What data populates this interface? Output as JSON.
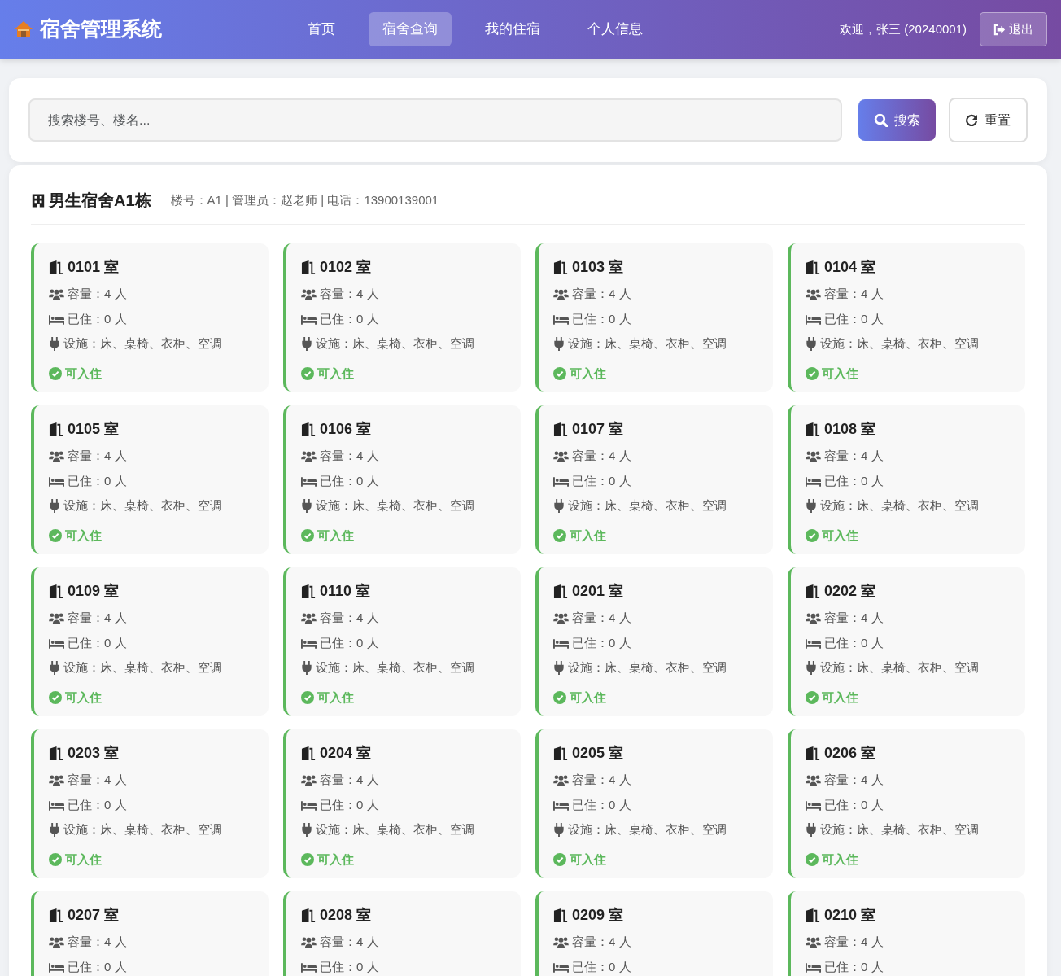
{
  "navbar": {
    "brand": "宿舍管理系统",
    "links": [
      {
        "label": "首页",
        "selected": false
      },
      {
        "label": "宿舍查询",
        "selected": true
      },
      {
        "label": "我的住宿",
        "selected": false
      },
      {
        "label": "个人信息",
        "selected": false
      }
    ],
    "welcome": "欢迎，张三 (20240001)",
    "logout": "退出"
  },
  "search": {
    "placeholder": "搜索楼号、楼名...",
    "search_button": "搜索",
    "reset_button": "重置"
  },
  "building": {
    "name": "男生宿舍A1栋",
    "info": "楼号：A1 | 管理员：赵老师 | 电话：13900139001"
  },
  "rooms": [
    {
      "title": "0101 室",
      "capacity": "容量：4 人",
      "occupied": "已住：0 人",
      "facilities": "设施：床、桌椅、衣柜、空调",
      "status": {
        "kind": "available",
        "text": "可入住"
      }
    },
    {
      "title": "0102 室",
      "capacity": "容量：4 人",
      "occupied": "已住：0 人",
      "facilities": "设施：床、桌椅、衣柜、空调",
      "status": {
        "kind": "available",
        "text": "可入住"
      }
    },
    {
      "title": "0103 室",
      "capacity": "容量：4 人",
      "occupied": "已住：0 人",
      "facilities": "设施：床、桌椅、衣柜、空调",
      "status": {
        "kind": "available",
        "text": "可入住"
      }
    },
    {
      "title": "0104 室",
      "capacity": "容量：4 人",
      "occupied": "已住：0 人",
      "facilities": "设施：床、桌椅、衣柜、空调",
      "status": {
        "kind": "available",
        "text": "可入住"
      }
    },
    {
      "title": "0105 室",
      "capacity": "容量：4 人",
      "occupied": "已住：0 人",
      "facilities": "设施：床、桌椅、衣柜、空调",
      "status": {
        "kind": "available",
        "text": "可入住"
      }
    },
    {
      "title": "0106 室",
      "capacity": "容量：4 人",
      "occupied": "已住：0 人",
      "facilities": "设施：床、桌椅、衣柜、空调",
      "status": {
        "kind": "available",
        "text": "可入住"
      }
    },
    {
      "title": "0107 室",
      "capacity": "容量：4 人",
      "occupied": "已住：0 人",
      "facilities": "设施：床、桌椅、衣柜、空调",
      "status": {
        "kind": "available",
        "text": "可入住"
      }
    },
    {
      "title": "0108 室",
      "capacity": "容量：4 人",
      "occupied": "已住：0 人",
      "facilities": "设施：床、桌椅、衣柜、空调",
      "status": {
        "kind": "available",
        "text": "可入住"
      }
    },
    {
      "title": "0109 室",
      "capacity": "容量：4 人",
      "occupied": "已住：0 人",
      "facilities": "设施：床、桌椅、衣柜、空调",
      "status": {
        "kind": "available",
        "text": "可入住"
      }
    },
    {
      "title": "0110 室",
      "capacity": "容量：4 人",
      "occupied": "已住：0 人",
      "facilities": "设施：床、桌椅、衣柜、空调",
      "status": {
        "kind": "available",
        "text": "可入住"
      }
    },
    {
      "title": "0201 室",
      "capacity": "容量：4 人",
      "occupied": "已住：0 人",
      "facilities": "设施：床、桌椅、衣柜、空调",
      "status": {
        "kind": "available",
        "text": "可入住"
      }
    },
    {
      "title": "0202 室",
      "capacity": "容量：4 人",
      "occupied": "已住：0 人",
      "facilities": "设施：床、桌椅、衣柜、空调",
      "status": {
        "kind": "available",
        "text": "可入住"
      }
    },
    {
      "title": "0203 室",
      "capacity": "容量：4 人",
      "occupied": "已住：0 人",
      "facilities": "设施：床、桌椅、衣柜、空调",
      "status": {
        "kind": "available",
        "text": "可入住"
      }
    },
    {
      "title": "0204 室",
      "capacity": "容量：4 人",
      "occupied": "已住：0 人",
      "facilities": "设施：床、桌椅、衣柜、空调",
      "status": {
        "kind": "available",
        "text": "可入住"
      }
    },
    {
      "title": "0205 室",
      "capacity": "容量：4 人",
      "occupied": "已住：0 人",
      "facilities": "设施：床、桌椅、衣柜、空调",
      "status": {
        "kind": "available",
        "text": "可入住"
      }
    },
    {
      "title": "0206 室",
      "capacity": "容量：4 人",
      "occupied": "已住：0 人",
      "facilities": "设施：床、桌椅、衣柜、空调",
      "status": {
        "kind": "available",
        "text": "可入住"
      }
    },
    {
      "title": "0207 室",
      "capacity": "容量：4 人",
      "occupied": "已住：0 人"
    },
    {
      "title": "0208 室",
      "capacity": "容量：4 人",
      "occupied": "已住：0 人"
    },
    {
      "title": "0209 室",
      "capacity": "容量：4 人",
      "occupied": "已住：0 人"
    },
    {
      "title": "0210 室",
      "capacity": "容量：4 人",
      "occupied": "已住：0 人"
    }
  ]
}
